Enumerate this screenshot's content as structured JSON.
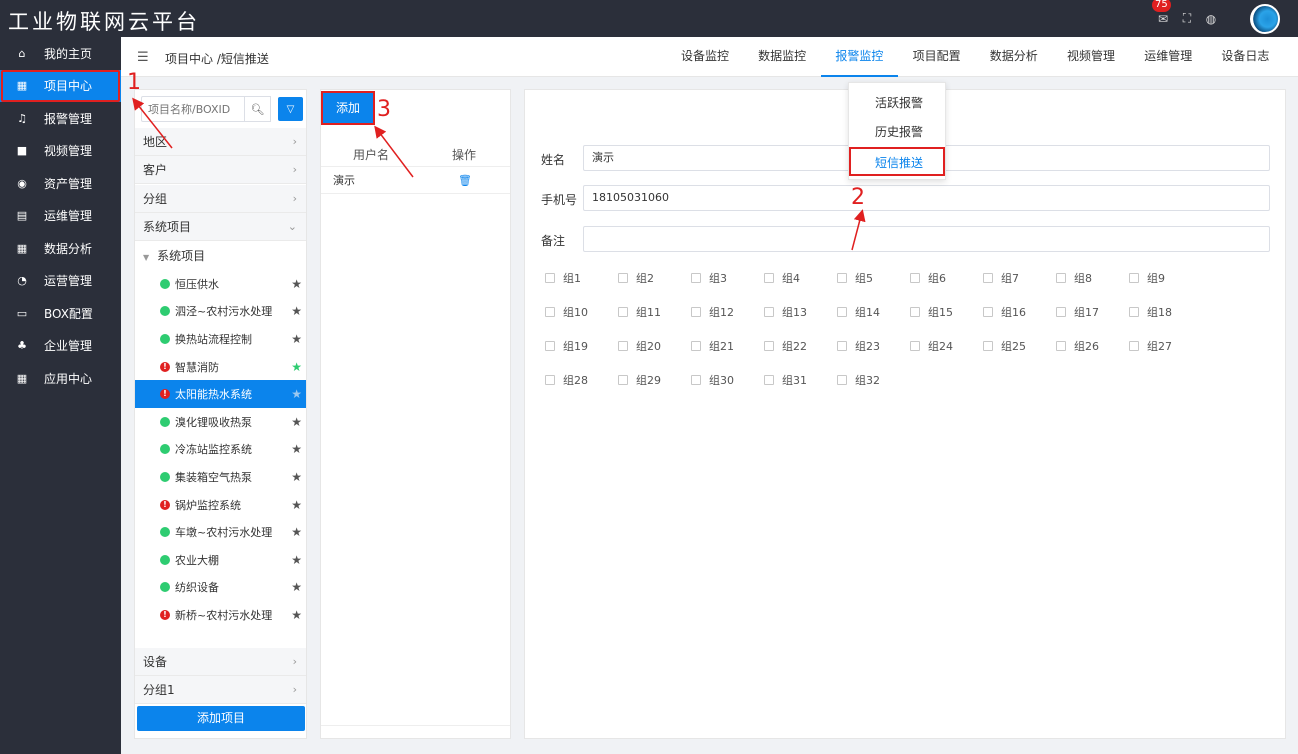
{
  "app": {
    "title": "工业物联网云平台",
    "notification_count": "75"
  },
  "leftnav": {
    "items": [
      {
        "label": "我的主页",
        "icon": "home-icon"
      },
      {
        "label": "项目中心",
        "icon": "grid-icon",
        "active": true
      },
      {
        "label": "报警管理",
        "icon": "bell-icon"
      },
      {
        "label": "视频管理",
        "icon": "video-icon"
      },
      {
        "label": "资产管理",
        "icon": "camera-icon"
      },
      {
        "label": "运维管理",
        "icon": "clipboard-icon"
      },
      {
        "label": "数据分析",
        "icon": "grid-icon"
      },
      {
        "label": "运营管理",
        "icon": "pie-icon"
      },
      {
        "label": "BOX配置",
        "icon": "monitor-icon"
      },
      {
        "label": "企业管理",
        "icon": "org-icon"
      },
      {
        "label": "应用中心",
        "icon": "grid-icon"
      }
    ]
  },
  "header": {
    "breadcrumb": "项目中心 /短信推送",
    "tabs": [
      "设备监控",
      "数据监控",
      "报警监控",
      "项目配置",
      "数据分析",
      "视频管理",
      "运维管理",
      "设备日志"
    ],
    "active_tab": "报警监控"
  },
  "dropdown": {
    "items": [
      "活跃报警",
      "历史报警",
      "短信推送"
    ],
    "active": "短信推送"
  },
  "project_panel": {
    "search_placeholder": "项目名称/BOXID",
    "sections_top": [
      "地区",
      "客户",
      "分组",
      "系统项目"
    ],
    "tree_parent": "系统项目",
    "projects": [
      {
        "name": "恒压供水",
        "status": "ok",
        "fav": false
      },
      {
        "name": "泗泾~农村污水处理",
        "status": "ok",
        "fav": false
      },
      {
        "name": "换热站流程控制",
        "status": "ok",
        "fav": false
      },
      {
        "name": "智慧消防",
        "status": "alarm",
        "fav": true
      },
      {
        "name": "太阳能热水系统",
        "status": "alarm",
        "fav": false,
        "selected": true
      },
      {
        "name": "溴化锂吸收热泵",
        "status": "ok",
        "fav": false
      },
      {
        "name": "冷冻站监控系统",
        "status": "ok",
        "fav": false
      },
      {
        "name": "集装箱空气热泵",
        "status": "ok",
        "fav": false
      },
      {
        "name": "锅炉监控系统",
        "status": "alarm",
        "fav": false
      },
      {
        "name": "车墩~农村污水处理",
        "status": "ok",
        "fav": false
      },
      {
        "name": "农业大棚",
        "status": "ok",
        "fav": false
      },
      {
        "name": "纺织设备",
        "status": "ok",
        "fav": false
      },
      {
        "name": "新桥~农村污水处理",
        "status": "alarm",
        "fav": false
      }
    ],
    "sections_bottom": [
      "设备",
      "分组1"
    ],
    "add_button": "添加项目"
  },
  "user_panel": {
    "add_button": "添加",
    "col_user": "用户名",
    "col_action": "操作",
    "rows": [
      {
        "name": "演示"
      }
    ]
  },
  "form": {
    "name_label": "姓名",
    "name_value": "演示",
    "phone_label": "手机号",
    "phone_value": "18105031060",
    "note_label": "备注",
    "note_value": "",
    "groups": [
      "组1",
      "组2",
      "组3",
      "组4",
      "组5",
      "组6",
      "组7",
      "组8",
      "组9",
      "组10",
      "组11",
      "组12",
      "组13",
      "组14",
      "组15",
      "组16",
      "组17",
      "组18",
      "组19",
      "组20",
      "组21",
      "组22",
      "组23",
      "组24",
      "组25",
      "组26",
      "组27",
      "组28",
      "组29",
      "组30",
      "组31",
      "组32"
    ]
  },
  "annotations": {
    "step1": "1",
    "step2": "2",
    "step3": "3",
    "color": "#e02020"
  },
  "colors": {
    "accent": "#0b84ec",
    "nav_bg": "#2b2f3a",
    "ok": "#2ecc71",
    "alarm": "#e02020"
  }
}
